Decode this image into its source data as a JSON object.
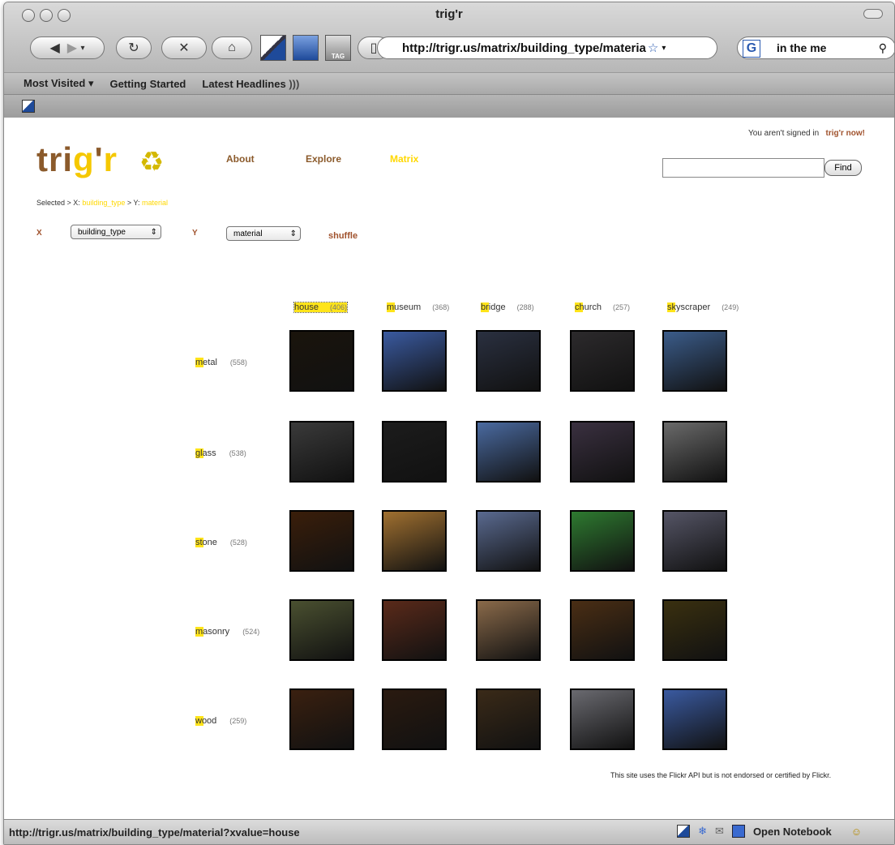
{
  "window": {
    "title": "trig'r"
  },
  "toolbar": {
    "url": "http://trigr.us/matrix/building_type/materia",
    "search_value": "in the me",
    "tag_label": "TAG",
    "search_engine": "G"
  },
  "bookmarks": [
    "Most Visited ▾",
    "Getting Started",
    "Latest Headlines"
  ],
  "site": {
    "logo": "trig'r",
    "nav": [
      "About",
      "Explore",
      "Matrix"
    ],
    "signin_text": "You aren't signed in",
    "signin_link": "trig'r now!",
    "find_button": "Find",
    "selected_prefix": "Selected > X:",
    "selected_x": "building_type",
    "selected_mid": "> Y:",
    "selected_y": "material",
    "x_label": "X",
    "y_label": "Y",
    "x_select": "building_type",
    "y_select": "material",
    "shuffle": "shuffle",
    "footer": "This site uses the Flickr API but is not endorsed or certified by Flickr."
  },
  "matrix": {
    "columns": [
      {
        "label": "house",
        "count": "(406)"
      },
      {
        "label": "museum",
        "count": "(368)"
      },
      {
        "label": "bridge",
        "count": "(288)"
      },
      {
        "label": "church",
        "count": "(257)"
      },
      {
        "label": "skyscraper",
        "count": "(249)"
      }
    ],
    "rows": [
      {
        "label": "metal",
        "count": "(558)"
      },
      {
        "label": "glass",
        "count": "(538)"
      },
      {
        "label": "stone",
        "count": "(528)"
      },
      {
        "label": "masonry",
        "count": "(524)"
      },
      {
        "label": "wood",
        "count": "(259)"
      }
    ],
    "colors": [
      [
        "#1a140c",
        "#3a5aa0",
        "#2a3040",
        "#2c2a2c",
        "#3b5c8a"
      ],
      [
        "#3a3a3a",
        "#1c1c1c",
        "#4a6aa0",
        "#3a3040",
        "#6a6a6a"
      ],
      [
        "#3a1e0a",
        "#a07030",
        "#5a6a90",
        "#2e7a30",
        "#555566"
      ],
      [
        "#4a5030",
        "#5a2a1a",
        "#8a6a4a",
        "#4a2e14",
        "#3a3010"
      ],
      [
        "#3a2010",
        "#2a1a10",
        "#3a2a18",
        "#6a6a70",
        "#3a5aa0"
      ]
    ]
  },
  "status": {
    "url": "http://trigr.us/matrix/building_type/material?xvalue=house",
    "notebook": "Open Notebook"
  }
}
